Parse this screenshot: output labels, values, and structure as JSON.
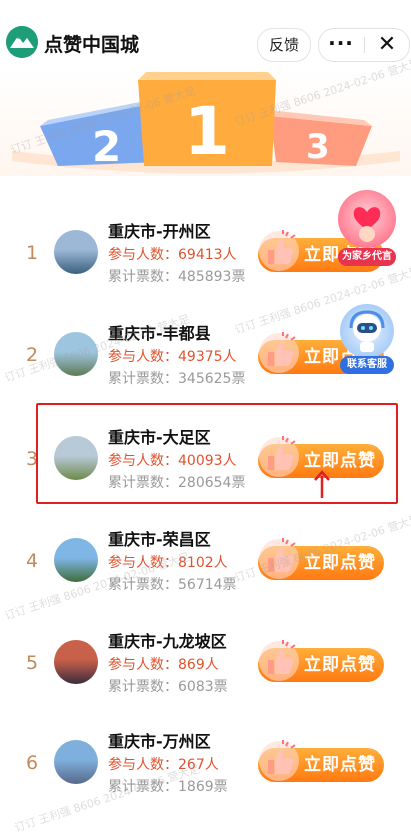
{
  "header": {
    "logo_label": "点赞中国城",
    "title": "点赞中国城",
    "feedback_label": "反馈",
    "more_icon": "···",
    "close_icon": "✕"
  },
  "podium": {
    "numbers": [
      "2",
      "1",
      "3"
    ]
  },
  "rankings": [
    {
      "rank": "1",
      "name": "重庆市-开州区",
      "participants": "参与人数：69413人",
      "votes": "累计票数：485893票",
      "button": "立即点赞",
      "thumb_colors": [
        "#9cb8d6",
        "#3a5f7e"
      ]
    },
    {
      "rank": "2",
      "name": "重庆市-丰都县",
      "participants": "参与人数：49375人",
      "votes": "累计票数：345625票",
      "button": "立即点赞",
      "thumb_colors": [
        "#9ec5e0",
        "#5d7b55"
      ]
    },
    {
      "rank": "3",
      "name": "重庆市-大足区",
      "participants": "参与人数：40093人",
      "votes": "累计票数：280654票",
      "button": "立即点赞",
      "thumb_colors": [
        "#b8c9d8",
        "#6d8a4a"
      ]
    },
    {
      "rank": "4",
      "name": "重庆市-荣昌区",
      "participants": "参与人数：8102人",
      "votes": "累计票数：56714票",
      "button": "立即点赞",
      "thumb_colors": [
        "#7fb6e6",
        "#3f6e3a"
      ]
    },
    {
      "rank": "5",
      "name": "重庆市-九龙坡区",
      "participants": "参与人数：869人",
      "votes": "累计票数：6083票",
      "button": "立即点赞",
      "thumb_colors": [
        "#c9604a",
        "#3a2c3c"
      ]
    },
    {
      "rank": "6",
      "name": "重庆市-万州区",
      "participants": "参与人数：267人",
      "votes": "累计票数：1869票",
      "button": "立即点赞",
      "thumb_colors": [
        "#7fb0dd",
        "#58688a"
      ]
    }
  ],
  "floating": {
    "hometown_label": "为家乡代言",
    "service_label": "联系客服"
  },
  "watermark_text": "订订 王利强 8606 2024-02-06 营大足",
  "colors": {
    "accent": "#ff8a1e",
    "rank": "#c28a5c",
    "participants": "#e0532f",
    "votes": "#9a9a9a",
    "highlight": "#e02020"
  }
}
